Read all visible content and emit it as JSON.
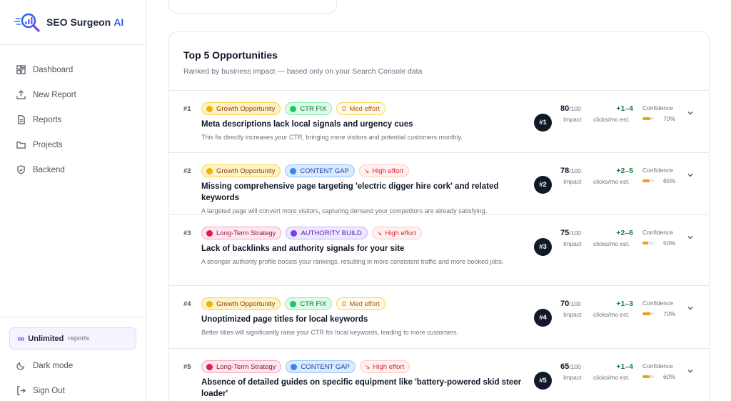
{
  "brand": {
    "name": "SEO Surgeon",
    "ai": "AI"
  },
  "nav": [
    {
      "label": "Dashboard",
      "icon": "dashboard-icon"
    },
    {
      "label": "New Report",
      "icon": "upload-icon"
    },
    {
      "label": "Reports",
      "icon": "document-icon"
    },
    {
      "label": "Projects",
      "icon": "folder-icon"
    },
    {
      "label": "Backend",
      "icon": "shield-icon"
    }
  ],
  "plan": {
    "symbol": "∞",
    "label": "Unlimited",
    "sub": "reports"
  },
  "bottom": {
    "dark_mode": "Dark mode",
    "sign_out": "Sign Out"
  },
  "panel": {
    "title": "Top 5 Opportunities",
    "subtitle": "Ranked by business impact — based only on your Search Console data"
  },
  "labels": {
    "impact": "Impact",
    "clicks": "clicks/mo est.",
    "confidence": "Confidence",
    "score_of": "/100"
  },
  "colors": {
    "accent": "#2563eb",
    "clicks_green": "#15803d",
    "confidence_bar": "#f59e0b"
  },
  "opportunities": [
    {
      "rank": "#1",
      "badge": "#1",
      "tags": [
        {
          "type": "growth",
          "label": "Growth Opportunity"
        },
        {
          "type": "ctr",
          "label": "CTR FIX"
        },
        {
          "type": "med",
          "label": "Med effort",
          "icon": "⏱"
        }
      ],
      "title": "Meta descriptions lack local signals and urgency cues",
      "description": "This fix directly increases your CTR, bringing more visitors and potential customers monthly.",
      "score": "80",
      "clicks": "+1–4",
      "confidence": "70%",
      "confidence_value": 0.7
    },
    {
      "rank": "#2",
      "badge": "#2",
      "tags": [
        {
          "type": "growth",
          "label": "Growth Opportunity"
        },
        {
          "type": "gap",
          "label": "CONTENT GAP"
        },
        {
          "type": "high",
          "label": "High effort",
          "icon": "↘"
        }
      ],
      "title": "Missing comprehensive page targeting 'electric digger hire cork' and related keywords",
      "description": "A targeted page will convert more visitors, capturing demand your competitors are already satisfying.",
      "score": "78",
      "clicks": "+2–5",
      "confidence": "65%",
      "confidence_value": 0.65
    },
    {
      "rank": "#3",
      "badge": "#3",
      "tags": [
        {
          "type": "longterm",
          "label": "Long-Term Strategy"
        },
        {
          "type": "auth",
          "label": "AUTHORITY BUILD"
        },
        {
          "type": "high",
          "label": "High effort",
          "icon": "↘"
        }
      ],
      "title": "Lack of backlinks and authority signals for your site",
      "description": "A stronger authority profile boosts your rankings, resulting in more consistent traffic and more booked jobs.",
      "score": "75",
      "clicks": "+2–6",
      "confidence": "50%",
      "confidence_value": 0.5
    },
    {
      "rank": "#4",
      "badge": "#4",
      "tags": [
        {
          "type": "growth",
          "label": "Growth Opportunity"
        },
        {
          "type": "ctr",
          "label": "CTR FIX"
        },
        {
          "type": "med",
          "label": "Med effort",
          "icon": "⏱"
        }
      ],
      "title": "Unoptimized page titles for local keywords",
      "description": "Better titles will significantly raise your CTR for local keywords, leading to more customers.",
      "score": "70",
      "clicks": "+1–3",
      "confidence": "70%",
      "confidence_value": 0.7
    },
    {
      "rank": "#5",
      "badge": "#5",
      "tags": [
        {
          "type": "longterm",
          "label": "Long-Term Strategy"
        },
        {
          "type": "gap",
          "label": "CONTENT GAP"
        },
        {
          "type": "high",
          "label": "High effort",
          "icon": "↘"
        }
      ],
      "title": "Absence of detailed guides on specific equipment like 'battery-powered skid steer loader'",
      "description": "",
      "score": "65",
      "clicks": "+1–4",
      "confidence": "60%",
      "confidence_value": 0.6
    }
  ]
}
